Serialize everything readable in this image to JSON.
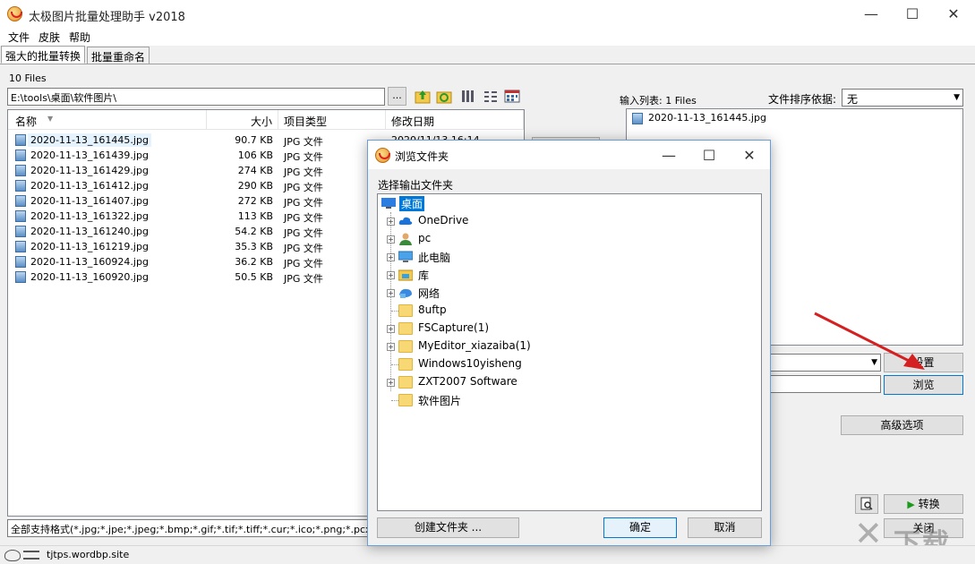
{
  "window": {
    "title": "太极图片批量处理助手  v2018",
    "min": "—",
    "max": "☐",
    "close": "✕"
  },
  "menu": [
    "文件",
    "皮肤",
    "帮助"
  ],
  "tabs": [
    "强大的批量转换",
    "批量重命名"
  ],
  "left": {
    "file_count": "10 Files",
    "path": "E:\\tools\\桌面\\软件图片\\",
    "browse_dots": "...",
    "columns": [
      "名称",
      "大小",
      "项目类型",
      "修改日期"
    ],
    "files": [
      {
        "name": "2020-11-13_161445.jpg",
        "size": "90.7 KB",
        "type": "JPG 文件",
        "date": "2020/11/13 16:14"
      },
      {
        "name": "2020-11-13_161439.jpg",
        "size": "106 KB",
        "type": "JPG 文件",
        "date": ""
      },
      {
        "name": "2020-11-13_161429.jpg",
        "size": "274 KB",
        "type": "JPG 文件",
        "date": ""
      },
      {
        "name": "2020-11-13_161412.jpg",
        "size": "290 KB",
        "type": "JPG 文件",
        "date": ""
      },
      {
        "name": "2020-11-13_161407.jpg",
        "size": "272 KB",
        "type": "JPG 文件",
        "date": ""
      },
      {
        "name": "2020-11-13_161322.jpg",
        "size": "113 KB",
        "type": "JPG 文件",
        "date": ""
      },
      {
        "name": "2020-11-13_161240.jpg",
        "size": "54.2 KB",
        "type": "JPG 文件",
        "date": ""
      },
      {
        "name": "2020-11-13_161219.jpg",
        "size": "35.3 KB",
        "type": "JPG 文件",
        "date": ""
      },
      {
        "name": "2020-11-13_160924.jpg",
        "size": "36.2 KB",
        "type": "JPG 文件",
        "date": ""
      },
      {
        "name": "2020-11-13_160920.jpg",
        "size": "50.5 KB",
        "type": "JPG 文件",
        "date": ""
      }
    ],
    "filter": "全部支持格式(*.jpg;*.jpe;*.jpeg;*.bmp;*.gif;*.tif;*.tiff;*.cur;*.ico;*.png;*.pcx;"
  },
  "right": {
    "input_list_label": "输入列表:  1 Files",
    "sort_label": "文件排序依据:",
    "sort_value": "无",
    "input_files": [
      "2020-11-13_161445.jpg"
    ],
    "settings_button": "设置",
    "browse_button": "浏览",
    "advanced_button": "高级选项",
    "convert_button": "转换",
    "close_button": "关闭"
  },
  "status": {
    "text": "tjtps.wordbp.site"
  },
  "watermark": "下载",
  "dialog": {
    "title": "浏览文件夹",
    "label": "选择输出文件夹",
    "tree": [
      {
        "label": "桌面"
      },
      {
        "label": "OneDrive"
      },
      {
        "label": "pc"
      },
      {
        "label": "此电脑"
      },
      {
        "label": "库"
      },
      {
        "label": "网络"
      },
      {
        "label": "8uftp"
      },
      {
        "label": "FSCapture(1)"
      },
      {
        "label": "MyEditor_xiazaiba(1)"
      },
      {
        "label": "Windows10yisheng"
      },
      {
        "label": "ZXT2007 Software"
      },
      {
        "label": "软件图片"
      }
    ],
    "new_folder_button": "创建文件夹 ...",
    "ok_button": "确定",
    "cancel_button": "取消"
  }
}
